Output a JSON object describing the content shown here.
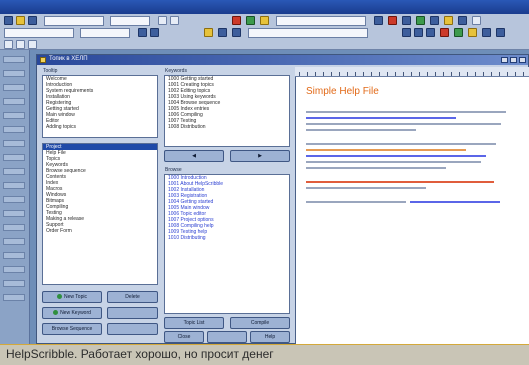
{
  "caption": "HelpScribble. Работает хорошо, но просит денег",
  "main_window": {
    "title": "Топик в ХЕЛП"
  },
  "panes": {
    "topics_label": "Tooltip",
    "keywords_label": "Keywords",
    "browse_label": "Browse"
  },
  "topics_list": [
    "Welcome",
    "Introduction",
    "System requirements",
    "Installation",
    "Registering",
    "Getting started",
    "Main window",
    "Editor",
    "Adding topics"
  ],
  "topic_tree": [
    "Project",
    "Help File",
    "Topics",
    "Keywords",
    "Browse sequence",
    "Contents",
    "Index",
    "Macros",
    "Windows",
    "Bitmaps",
    "Compiling",
    "Testing",
    "Making a release",
    "Support",
    "Order Form"
  ],
  "keywords_list": [
    "1000 Getting started",
    "1001 Creating topics",
    "1002 Editing topics",
    "1003 Using keywords",
    "1004 Browse sequence",
    "1005 Index entries",
    "1006 Compiling",
    "1007 Testing",
    "1008 Distribution"
  ],
  "browse_list": [
    "1000 Introduction",
    "1001 About HelpScribble",
    "1002 Installation",
    "1003 Registration",
    "1004 Getting started",
    "1005 Main window",
    "1006 Topic editor",
    "1007 Project options",
    "1008 Compiling help",
    "1009 Testing help",
    "1010 Distributing"
  ],
  "buttons": {
    "new_topic": "New Topic",
    "delete": "Delete",
    "new_keyword": "New Keyword",
    "browse_sequence": "Browse Sequence",
    "topic_list": "Topic List",
    "compile": "Compile",
    "close": "Close",
    "help": "Help"
  },
  "editor": {
    "title": "Simple Help File"
  },
  "icons": {
    "app_window": "window-icon",
    "minimize": "minimize-icon",
    "maximize": "maximize-icon",
    "close": "close-icon"
  },
  "colors": {
    "selection": "#1f4aa8",
    "editor_title": "#e26a18",
    "link": "#2b3fd1"
  }
}
